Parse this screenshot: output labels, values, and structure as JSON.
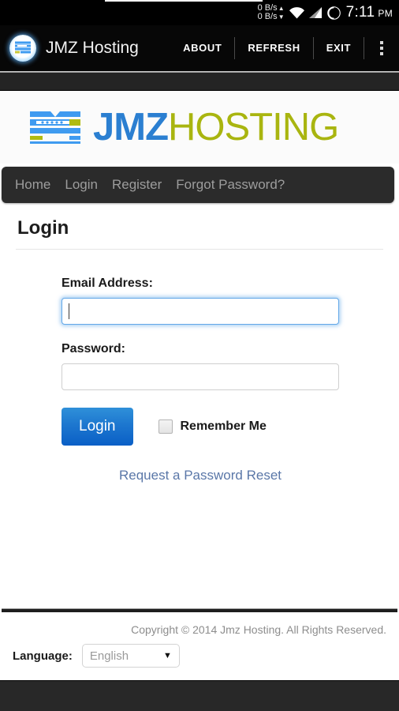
{
  "statusbar": {
    "net_up": "0 B/s",
    "net_down": "0 B/s",
    "up_arrow": "▲",
    "down_arrow": "▼",
    "time": "7:11",
    "ampm": "PM",
    "wifi_icon": "wifi-icon",
    "signal_icon": "signal-icon",
    "spinner_icon": "loading-spinner-icon"
  },
  "actionbar": {
    "app_title": "JMZ Hosting",
    "app_icon": "jmz-app-icon",
    "buttons": [
      {
        "label": "ABOUT"
      },
      {
        "label": "REFRESH"
      },
      {
        "label": "EXIT"
      }
    ],
    "overflow_icon": "overflow-menu-icon"
  },
  "brand": {
    "logo_icon": "jmz-server-bars-icon",
    "name_primary": "JMZ",
    "name_secondary": "HOSTING",
    "color_primary": "#2b7fd1",
    "color_secondary": "#a9b510"
  },
  "nav": {
    "items": [
      {
        "label": "Home"
      },
      {
        "label": "Login"
      },
      {
        "label": "Register"
      },
      {
        "label": "Forgot Password?"
      }
    ]
  },
  "page": {
    "title": "Login"
  },
  "form": {
    "email_label": "Email Address:",
    "email_value": "",
    "email_placeholder": "",
    "password_label": "Password:",
    "password_value": "",
    "password_placeholder": "",
    "login_button": "Login",
    "remember_label": "Remember Me",
    "remember_checked": false,
    "reset_link": "Request a Password Reset"
  },
  "footer": {
    "copyright": "Copyright © 2014 Jmz Hosting. All Rights Reserved.",
    "language_label": "Language:",
    "language_value": "English",
    "language_arrow": "▼"
  }
}
